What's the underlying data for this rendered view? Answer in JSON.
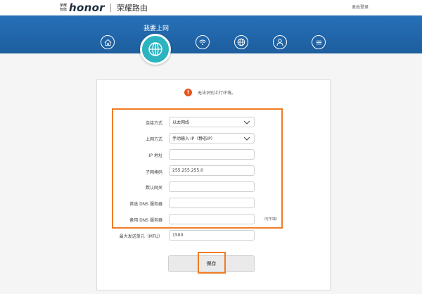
{
  "header": {
    "brand_small_line1": "荣耀",
    "brand_small_line2": "智能",
    "brand_logo": "honor",
    "brand_name": "荣耀路由",
    "logout": "退出登录"
  },
  "nav": {
    "active_title": "我要上网",
    "icons": [
      "home-icon",
      "globe-icon",
      "wifi-icon",
      "network-icon",
      "user-icon",
      "menu-icon"
    ],
    "colors": {
      "band": "#1d5e9e",
      "active": "#2bb3c0"
    }
  },
  "status": {
    "message": "无法识别上行环境。",
    "icon_glyph": "!",
    "color": "#e8541e"
  },
  "form": {
    "connection_type_label": "连接方式",
    "connection_type_value": "以太网线",
    "access_mode_label": "上网方式",
    "access_mode_value": "手动输入 IP（静态IP）",
    "ip_label": "IP 地址",
    "ip_value": "",
    "mask_label": "子网掩码",
    "mask_value": "255.255.255.0",
    "gateway_label": "默认网关",
    "gateway_value": "",
    "dns1_label": "首选 DNS 服务器",
    "dns1_value": "",
    "dns2_label": "备用 DNS 服务器",
    "dns2_value": "",
    "dns2_hint": "（可不填）",
    "mtu_label": "最大发送单元（MTU）",
    "mtu_value": "1500",
    "save_label": "保存"
  },
  "highlight_color": "#f07c24"
}
